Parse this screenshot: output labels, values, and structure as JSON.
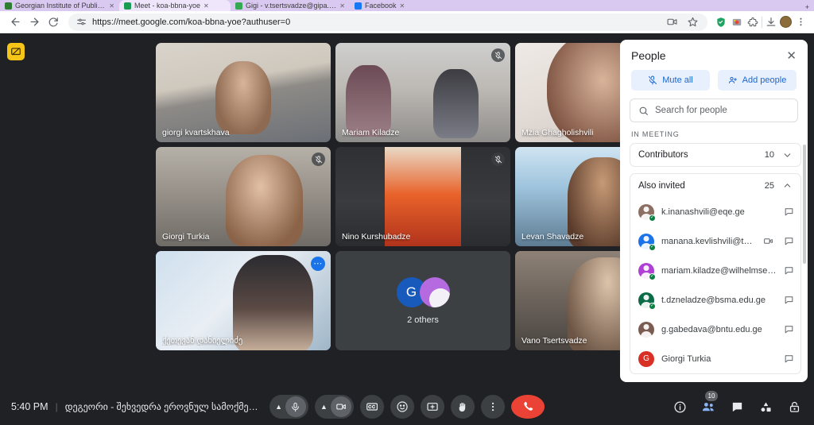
{
  "browser": {
    "tabs": [
      {
        "title": "Georgian Institute of Public Aff",
        "favicon_color": "#2e7d32",
        "active": false
      },
      {
        "title": "Meet - koa-bbna-yoe",
        "favicon_color": "#1a9c52",
        "active": true
      },
      {
        "title": "Gigi - v.tsertsvadze@gipa.ge",
        "favicon_color": "#ea4335",
        "active": false
      },
      {
        "title": "Facebook",
        "favicon_color": "#1877f2",
        "active": false
      }
    ],
    "url": "https://meet.google.com/koa-bbna-yoe?authuser=0",
    "back_icon": "back-arrow-icon",
    "forward_icon": "forward-arrow-icon",
    "reload_icon": "reload-icon",
    "site_settings_icon": "tune-icon",
    "toolbar_icons": [
      "share-screen-icon",
      "bookmark-star-icon",
      "shield-extension-icon",
      "adblock-extension-icon",
      "extensions-puzzle-icon",
      "downloads-icon",
      "profile-avatar-icon",
      "chrome-menu-icon"
    ]
  },
  "meet": {
    "rail_icon": "presentation-blocked-icon",
    "tiles": [
      {
        "name": "giorgi kvartskhava",
        "muted": false,
        "selected": false,
        "style": "v1"
      },
      {
        "name": "Mariam Kiladze",
        "muted": true,
        "selected": false,
        "style": "v2"
      },
      {
        "name": "Mzia Ghagholishvili",
        "muted": true,
        "selected": false,
        "style": "v3"
      },
      {
        "name": "Giorgi Turkia",
        "muted": true,
        "selected": false,
        "style": "v4"
      },
      {
        "name": "Nino Kurshubadze",
        "muted": true,
        "selected": false,
        "style": "v5"
      },
      {
        "name": "Levan Shavadze",
        "muted": true,
        "selected": false,
        "style": "v6"
      },
      {
        "name": "ქეთევან დანიელიძე",
        "muted": false,
        "selected": true,
        "style": "v7"
      },
      {
        "name": "2 others",
        "others": true,
        "avatar_letter": "G"
      },
      {
        "name": "Vano Tsertsvadze",
        "muted": false,
        "selected": false,
        "style": "v8"
      }
    ]
  },
  "people_panel": {
    "title": "People",
    "close_icon": "close-icon",
    "mute_all_label": "Mute all",
    "mute_all_icon": "mic-off-icon",
    "add_people_label": "Add people",
    "add_people_icon": "person-add-icon",
    "search_placeholder": "Search for people",
    "search_icon": "search-icon",
    "search_value": "",
    "section_label": "IN MEETING",
    "groups": [
      {
        "label": "Contributors",
        "count": "10",
        "expanded": false,
        "chevron": "chevron-down-icon"
      },
      {
        "label": "Also invited",
        "count": "25",
        "expanded": true,
        "chevron": "chevron-up-icon"
      }
    ],
    "participants": [
      {
        "name": "k.inanashvili@eqe.ge",
        "color": "#8d6e63",
        "letter": "",
        "invited_check": true,
        "has_video_icon": false
      },
      {
        "name": "manana.kevlishvili@tesau.e…",
        "color": "#1a73e8",
        "letter": "",
        "invited_check": true,
        "has_video_icon": true
      },
      {
        "name": "mariam.kiladze@wilhelmsen.com",
        "color": "#b03fd4",
        "letter": "",
        "invited_check": true,
        "has_video_icon": false
      },
      {
        "name": "t.dzneladze@bsma.edu.ge",
        "color": "#0b6b47",
        "letter": "",
        "invited_check": true,
        "has_video_icon": false
      },
      {
        "name": "g.gabedava@bntu.edu.ge",
        "color": "#7a5c52",
        "letter": "",
        "invited_check": false,
        "has_video_icon": false
      },
      {
        "name": "Giorgi Turkia",
        "color": "#d93025",
        "letter": "G",
        "invited_check": false,
        "has_video_icon": false
      }
    ],
    "chat_icon": "chat-bubble-icon",
    "video_icon": "video-camera-icon"
  },
  "bottom_bar": {
    "time": "5:40 PM",
    "divider": "|",
    "meeting_title": "დეგეორი - შეხვედრა ეროვნულ სამოქმედო გე…",
    "controls": [
      {
        "name": "microphone-toggle",
        "icon": "mic-icon",
        "has_chevron": true
      },
      {
        "name": "camera-toggle",
        "icon": "video-camera-icon",
        "has_chevron": true
      },
      {
        "name": "captions-toggle",
        "icon": "closed-captions-icon",
        "has_chevron": false
      },
      {
        "name": "emoji-reactions",
        "icon": "emoji-smile-icon",
        "has_chevron": false
      },
      {
        "name": "present-screen",
        "icon": "present-screen-icon",
        "has_chevron": false
      },
      {
        "name": "raise-hand",
        "icon": "raise-hand-icon",
        "has_chevron": false
      },
      {
        "name": "more-options",
        "icon": "more-vertical-icon",
        "has_chevron": false
      },
      {
        "name": "leave-call",
        "icon": "end-call-icon",
        "has_chevron": false
      }
    ],
    "right_icons": [
      {
        "name": "meeting-details",
        "icon": "info-icon",
        "badge": "",
        "active": false
      },
      {
        "name": "people-panel-toggle",
        "icon": "people-icon",
        "badge": "10",
        "active": true
      },
      {
        "name": "chat-panel-toggle",
        "icon": "chat-bubble-icon",
        "badge": "",
        "active": false
      },
      {
        "name": "activities-panel-toggle",
        "icon": "activities-shapes-icon",
        "badge": "",
        "active": false
      },
      {
        "name": "host-controls-toggle",
        "icon": "host-lock-icon",
        "badge": "",
        "active": false
      }
    ]
  },
  "colors": {
    "accent_blue": "#1a73e8",
    "light_blue": "#8ab4f8",
    "end_call_red": "#ea4335",
    "dark_bg": "#202124",
    "tile_bg": "#3c4043"
  }
}
